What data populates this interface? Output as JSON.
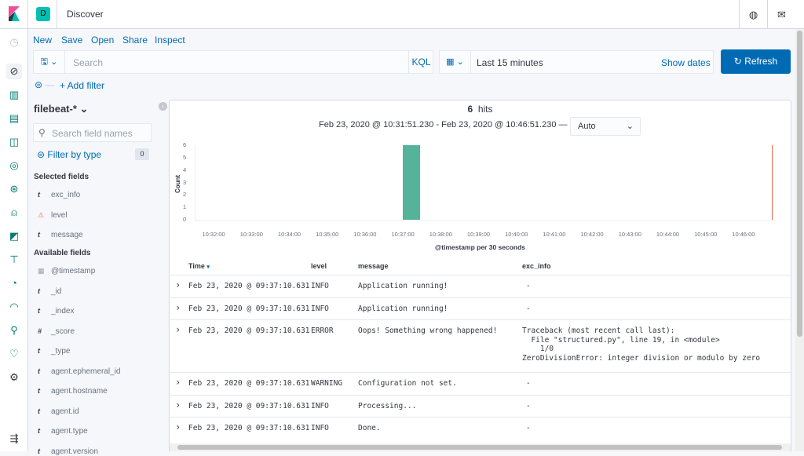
{
  "header": {
    "space_initial": "D",
    "title": "Discover",
    "icons": [
      "globe-icon",
      "mail-icon"
    ]
  },
  "rail": {
    "icons": [
      "clock-icon",
      "compass-icon",
      "visualize-icon",
      "dashboard-icon",
      "canvas-icon",
      "maps-icon",
      "ml-icon",
      "metrics-icon",
      "logs-icon",
      "apm-icon",
      "uptime-icon",
      "siem-icon",
      "dev-tools-icon",
      "monitoring-icon",
      "management-icon",
      "collapse-icon"
    ]
  },
  "menu": {
    "new": "New",
    "save": "Save",
    "open": "Open",
    "share": "Share",
    "inspect": "Inspect"
  },
  "query": {
    "placeholder": "Search",
    "language": "KQL"
  },
  "time": {
    "range": "Last 15 minutes",
    "show_dates": "Show dates",
    "refresh": "Refresh"
  },
  "filter": {
    "add": "+ Add filter"
  },
  "sidebar": {
    "index": "filebeat-*",
    "search_placeholder": "Search field names",
    "filter_by_type": "Filter by type",
    "filter_count": "0",
    "selected_title": "Selected fields",
    "selected": [
      {
        "type": "t",
        "name": "exc_info"
      },
      {
        "type": "warn",
        "name": "level"
      },
      {
        "type": "t",
        "name": "message"
      }
    ],
    "available_title": "Available fields",
    "available": [
      {
        "type": "date",
        "name": "@timestamp"
      },
      {
        "type": "t",
        "name": "_id"
      },
      {
        "type": "t",
        "name": "_index"
      },
      {
        "type": "#",
        "name": "_score"
      },
      {
        "type": "t",
        "name": "_type"
      },
      {
        "type": "t",
        "name": "agent.ephemeral_id"
      },
      {
        "type": "t",
        "name": "agent.hostname"
      },
      {
        "type": "t",
        "name": "agent.id"
      },
      {
        "type": "t",
        "name": "agent.type"
      },
      {
        "type": "t",
        "name": "agent.version"
      }
    ]
  },
  "results": {
    "hits": "6",
    "hits_label": "hits",
    "range": "Feb 23, 2020 @ 10:31:51.230 - Feb 23, 2020 @ 10:46:51.230 —",
    "interval": "Auto"
  },
  "chart_data": {
    "type": "bar",
    "xlabel": "@timestamp per 30 seconds",
    "ylabel": "Count",
    "ylim": [
      0,
      6
    ],
    "yticks": [
      "0",
      "1",
      "2",
      "3",
      "4",
      "5",
      "6"
    ],
    "xticks": [
      "10:32:00",
      "10:33:00",
      "10:34:00",
      "10:35:00",
      "10:36:00",
      "10:37:00",
      "10:38:00",
      "10:39:00",
      "10:40:00",
      "10:41:00",
      "10:42:00",
      "10:43:00",
      "10:44:00",
      "10:45:00",
      "10:46:00"
    ],
    "bars": [
      {
        "x": "10:37:00",
        "value": 6
      }
    ],
    "now_marker": "10:46:51",
    "bar_color": "#54b399",
    "marker_color": "#e7664c"
  },
  "table": {
    "columns": [
      "Time",
      "level",
      "message",
      "exc_info"
    ],
    "rows": [
      {
        "time": "Feb 23, 2020 @ 09:37:10.631",
        "level": "INFO",
        "message": "Application running!",
        "exc_info": "-"
      },
      {
        "time": "Feb 23, 2020 @ 09:37:10.631",
        "level": "INFO",
        "message": "Application running!",
        "exc_info": "-"
      },
      {
        "time": "Feb 23, 2020 @ 09:37:10.631",
        "level": "ERROR",
        "message": "Oops! Something wrong happened!",
        "exc_info": "Traceback (most recent call last):\n  File \"structured.py\", line 19, in <module>\n    1/0\nZeroDivisionError: integer division or modulo by zero"
      },
      {
        "time": "Feb 23, 2020 @ 09:37:10.631",
        "level": "WARNING",
        "message": "Configuration not set.",
        "exc_info": "-"
      },
      {
        "time": "Feb 23, 2020 @ 09:37:10.631",
        "level": "INFO",
        "message": "Processing...",
        "exc_info": "-"
      },
      {
        "time": "Feb 23, 2020 @ 09:37:10.631",
        "level": "INFO",
        "message": "Done.",
        "exc_info": "-"
      }
    ]
  }
}
